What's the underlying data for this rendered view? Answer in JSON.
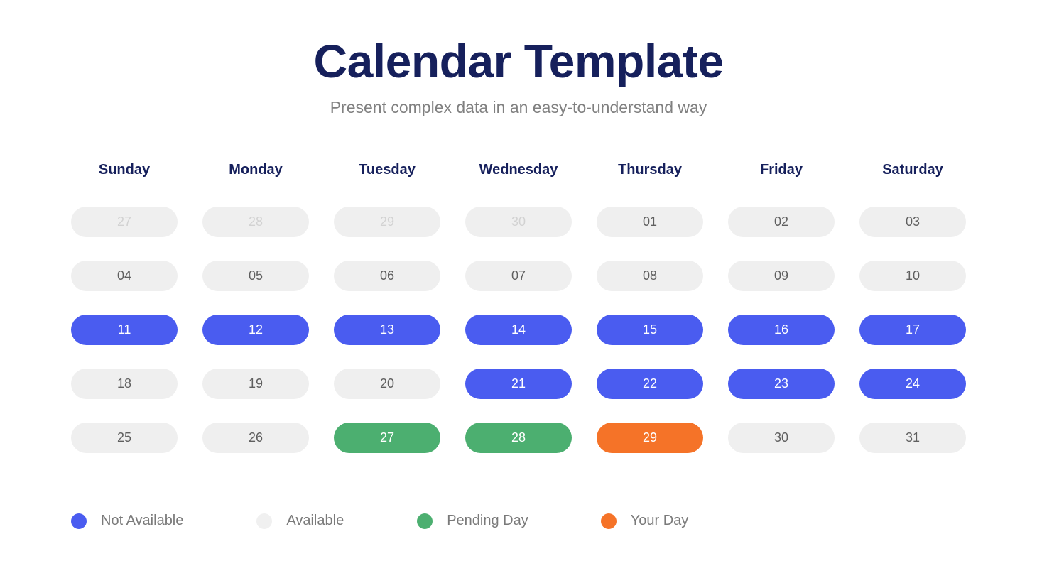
{
  "header": {
    "title": "Calendar Template",
    "subtitle": "Present complex data in an easy-to-understand way",
    "title_color": "#16205C",
    "subtitle_color": "#808080"
  },
  "calendar": {
    "weekdays": [
      "Sunday",
      "Monday",
      "Tuesday",
      "Wednesday",
      "Thursday",
      "Friday",
      "Saturday"
    ],
    "weeks": [
      [
        {
          "day": "27",
          "state": "muted"
        },
        {
          "day": "28",
          "state": "muted"
        },
        {
          "day": "29",
          "state": "muted"
        },
        {
          "day": "30",
          "state": "muted"
        },
        {
          "day": "01",
          "state": "available"
        },
        {
          "day": "02",
          "state": "available"
        },
        {
          "day": "03",
          "state": "available"
        }
      ],
      [
        {
          "day": "04",
          "state": "available"
        },
        {
          "day": "05",
          "state": "available"
        },
        {
          "day": "06",
          "state": "available"
        },
        {
          "day": "07",
          "state": "available"
        },
        {
          "day": "08",
          "state": "available"
        },
        {
          "day": "09",
          "state": "available"
        },
        {
          "day": "10",
          "state": "available"
        }
      ],
      [
        {
          "day": "11",
          "state": "unavailable"
        },
        {
          "day": "12",
          "state": "unavailable"
        },
        {
          "day": "13",
          "state": "unavailable"
        },
        {
          "day": "14",
          "state": "unavailable"
        },
        {
          "day": "15",
          "state": "unavailable"
        },
        {
          "day": "16",
          "state": "unavailable"
        },
        {
          "day": "17",
          "state": "unavailable"
        }
      ],
      [
        {
          "day": "18",
          "state": "available"
        },
        {
          "day": "19",
          "state": "available"
        },
        {
          "day": "20",
          "state": "available"
        },
        {
          "day": "21",
          "state": "unavailable"
        },
        {
          "day": "22",
          "state": "unavailable"
        },
        {
          "day": "23",
          "state": "unavailable"
        },
        {
          "day": "24",
          "state": "unavailable"
        }
      ],
      [
        {
          "day": "25",
          "state": "available"
        },
        {
          "day": "26",
          "state": "available"
        },
        {
          "day": "27",
          "state": "pending"
        },
        {
          "day": "28",
          "state": "pending"
        },
        {
          "day": "29",
          "state": "yourday"
        },
        {
          "day": "30",
          "state": "available"
        },
        {
          "day": "31",
          "state": "available"
        }
      ]
    ]
  },
  "legend": {
    "items": [
      {
        "label": "Not Available",
        "color": "#4A5CF0",
        "state": "unavailable",
        "gap_after": 103
      },
      {
        "label": "Available",
        "color": "#F0F0F0",
        "state": "available",
        "gap_after": 103
      },
      {
        "label": "Pending Day",
        "color": "#4CAF70",
        "state": "pending",
        "gap_after": 102
      },
      {
        "label": "Your Day",
        "color": "#F57328",
        "state": "yourday",
        "gap_after": 0
      }
    ]
  },
  "colors": {
    "navy": "#16205C",
    "blue": "#4A5CF0",
    "green": "#4CAF70",
    "orange": "#F57328",
    "pill_gray": "#EFEFEF",
    "text_gray": "#5F5F5F",
    "muted_gray": "#D2D2D2",
    "background": "#FFFFFF"
  }
}
